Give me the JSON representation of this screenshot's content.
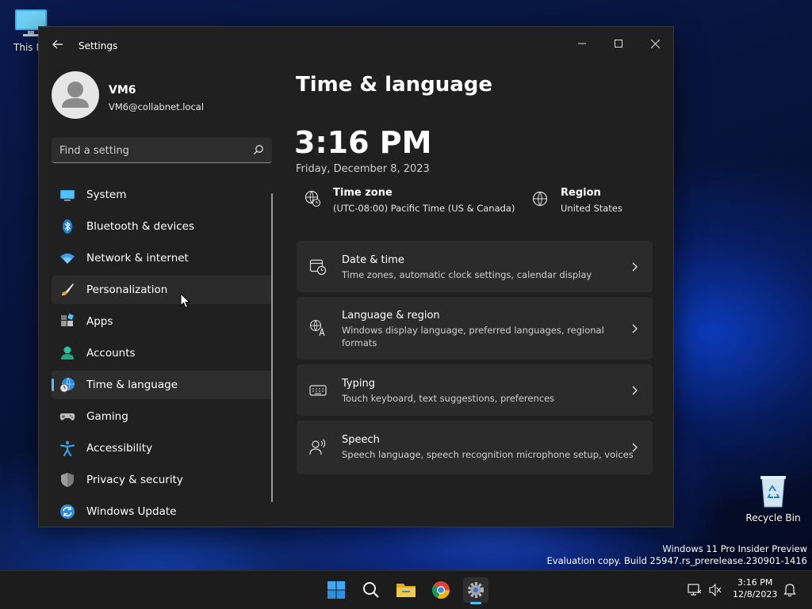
{
  "desktop": {
    "this_pc_label": "This PC",
    "recycle_bin_label": "Recycle Bin",
    "watermark_line1": "Windows 11 Pro Insider Preview",
    "watermark_line2": "Evaluation copy. Build 25947.rs_prerelease.230901-1416"
  },
  "window": {
    "title": "Settings",
    "back_icon": "back-arrow-icon",
    "controls": [
      "minimize-icon",
      "maximize-icon",
      "close-icon"
    ]
  },
  "profile": {
    "name": "VM6",
    "email": "VM6@collabnet.local"
  },
  "search": {
    "placeholder": "Find a setting"
  },
  "nav": {
    "items": [
      {
        "label": "System",
        "icon": "monitor-icon",
        "state": "normal"
      },
      {
        "label": "Bluetooth & devices",
        "icon": "bluetooth-icon",
        "state": "normal"
      },
      {
        "label": "Network & internet",
        "icon": "wifi-icon",
        "state": "normal"
      },
      {
        "label": "Personalization",
        "icon": "brush-icon",
        "state": "hover"
      },
      {
        "label": "Apps",
        "icon": "apps-icon",
        "state": "normal"
      },
      {
        "label": "Accounts",
        "icon": "person-icon",
        "state": "normal"
      },
      {
        "label": "Time & language",
        "icon": "globe-clock-icon",
        "state": "active"
      },
      {
        "label": "Gaming",
        "icon": "gamepad-icon",
        "state": "normal"
      },
      {
        "label": "Accessibility",
        "icon": "accessibility-icon",
        "state": "normal"
      },
      {
        "label": "Privacy & security",
        "icon": "shield-icon",
        "state": "normal"
      },
      {
        "label": "Windows Update",
        "icon": "update-icon",
        "state": "normal"
      }
    ]
  },
  "main": {
    "title": "Time & language",
    "clock": "3:16 PM",
    "date": "Friday, December 8, 2023",
    "timezone": {
      "title": "Time zone",
      "value": "(UTC-08:00) Pacific Time (US & Canada)"
    },
    "region": {
      "title": "Region",
      "value": "United States"
    },
    "cards": [
      {
        "title": "Date & time",
        "desc": "Time zones, automatic clock settings, calendar display",
        "icon": "calendar-clock-icon"
      },
      {
        "title": "Language & region",
        "desc": "Windows display language, preferred languages, regional formats",
        "icon": "language-icon"
      },
      {
        "title": "Typing",
        "desc": "Touch keyboard, text suggestions, preferences",
        "icon": "keyboard-icon"
      },
      {
        "title": "Speech",
        "desc": "Speech language, speech recognition microphone setup, voices",
        "icon": "speech-icon"
      }
    ]
  },
  "taskbar": {
    "apps": [
      "start-icon",
      "search-icon",
      "file-explorer-icon",
      "chrome-icon",
      "settings-icon"
    ],
    "time": "3:16 PM",
    "date": "12/8/2023"
  },
  "colors": {
    "accent": "#4cc2ff",
    "window_bg": "#202020",
    "card_bg": "#2b2b2b"
  }
}
